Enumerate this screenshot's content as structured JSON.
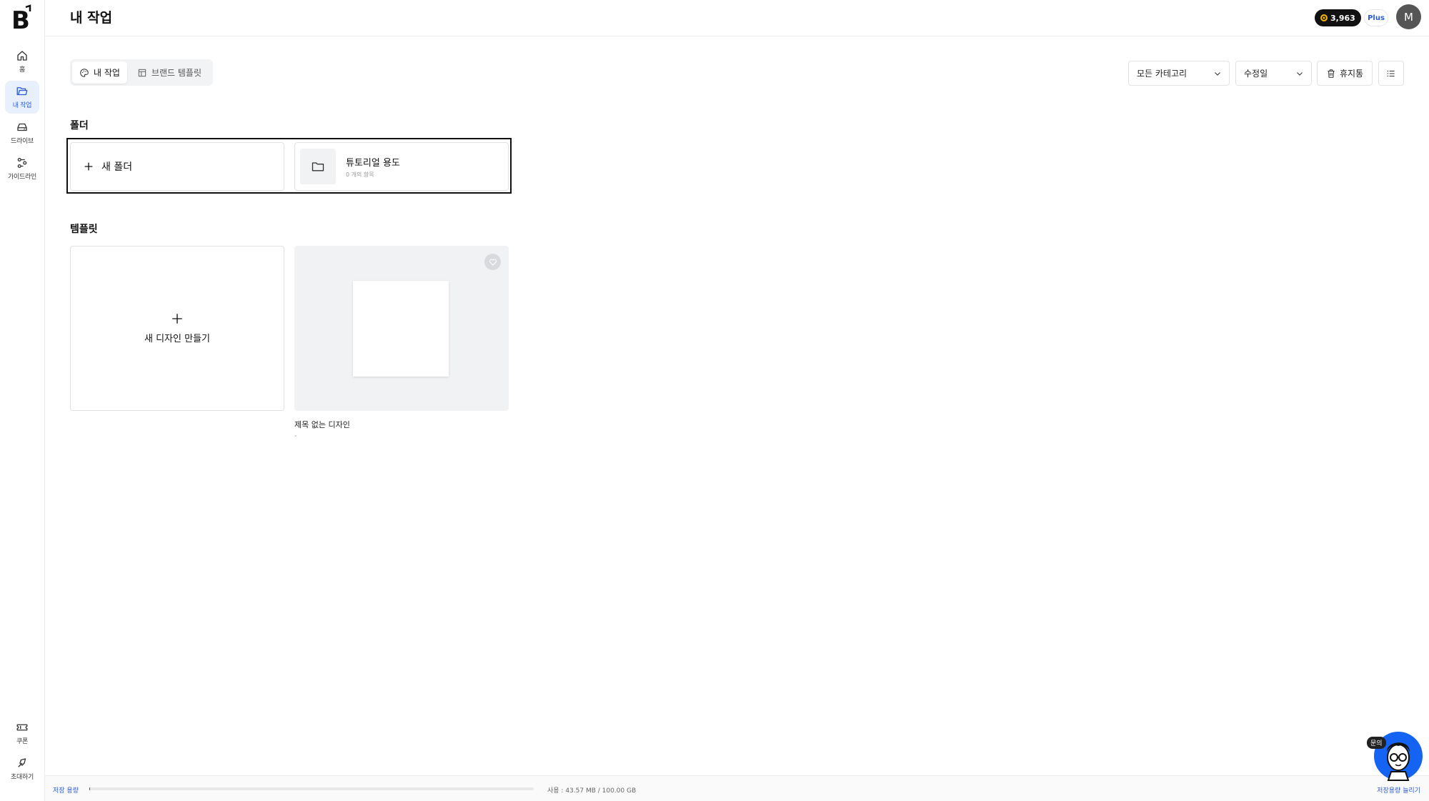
{
  "app": {
    "logo_text": "B",
    "page_title": "내 작업"
  },
  "header": {
    "credits": "3,963",
    "plan_badge": "Plus",
    "avatar_initial": "M"
  },
  "sidebar": {
    "items": [
      {
        "label": "홈",
        "icon": "home-icon"
      },
      {
        "label": "내 작업",
        "icon": "folder-open-icon",
        "active": true
      },
      {
        "label": "드라이브",
        "icon": "drive-icon"
      },
      {
        "label": "가이드라인",
        "icon": "guideline-icon"
      }
    ],
    "bottom_items": [
      {
        "label": "쿠폰",
        "icon": "ticket-icon"
      },
      {
        "label": "초대하기",
        "icon": "invite-icon"
      }
    ]
  },
  "tabs": [
    {
      "label": "내 작업",
      "icon": "palette-icon",
      "active": true
    },
    {
      "label": "브랜드 템플릿",
      "icon": "layout-icon",
      "active": false
    }
  ],
  "toolbar": {
    "category_select": "모든 카테고리",
    "sort_select": "수정일",
    "trash_label": "휴지통",
    "view_icon": "list-view-icon"
  },
  "folders_section": {
    "title": "폴더",
    "new_folder_label": "새 폴더",
    "folders": [
      {
        "name": "튜토리얼 용도",
        "count": "0 개의 항목"
      }
    ]
  },
  "templates_section": {
    "title": "템플릿",
    "new_design_label": "새 디자인 만들기",
    "designs": [
      {
        "name": "제목 없는 디자인",
        "date": "-"
      }
    ]
  },
  "storage": {
    "label": "저장 용량",
    "usage": "사용 : 43.57 MB / 100.00 GB",
    "used_fraction": 0.0004,
    "upgrade_label": "저장용량 늘리기"
  },
  "chat_widget": {
    "bubble_label": "문의"
  },
  "colors": {
    "accent": "#2a5bd7",
    "active_bg": "#e9f0fd",
    "chat_blue": "#1463f3"
  }
}
